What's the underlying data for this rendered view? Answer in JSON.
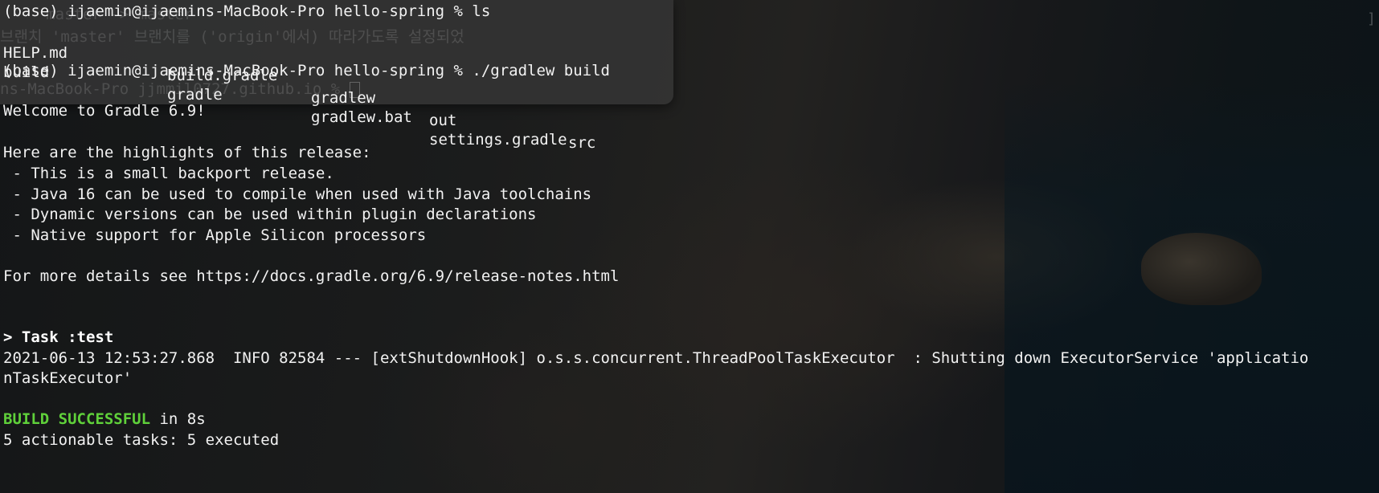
{
  "previous_window_ghost": {
    "line1": "     master -> master",
    "line2": "브랜치 'master' 브랜치를 ('origin'에서) 따라가도록 설정되었",
    "line3": "ns-MacBook-Pro jjmmil0727.github.io % "
  },
  "terminal": {
    "prompt_ls": "(base) ijaemin@ijaemins-MacBook-Pro hello-spring % ls",
    "ls_rows": [
      [
        "HELP.md",
        "build.gradle",
        "gradlew",
        "out",
        "src"
      ],
      [
        "build",
        "gradle",
        "gradlew.bat",
        "settings.gradle",
        ""
      ]
    ],
    "prompt_build": "(base) ijaemin@ijaemins-MacBook-Pro hello-spring % ./gradlew build",
    "welcome": "Welcome to Gradle 6.9!",
    "highlights_heading": "Here are the highlights of this release:",
    "highlights": [
      " - This is a small backport release.",
      " - Java 16 can be used to compile when used with Java toolchains",
      " - Dynamic versions can be used within plugin declarations",
      " - Native support for Apple Silicon processors"
    ],
    "details": "For more details see https://docs.gradle.org/6.9/release-notes.html",
    "task": "> Task :test",
    "log_line1": "2021-06-13 12:53:27.868  INFO 82584 --- [extShutdownHook] o.s.s.concurrent.ThreadPoolTaskExecutor  : Shutting down ExecutorService 'applicatio",
    "log_line2": "nTaskExecutor'",
    "build_status": "BUILD SUCCESSFUL",
    "build_time": " in 8s",
    "tasks_summary": "5 actionable tasks: 5 executed"
  },
  "colors": {
    "success": "#5fd03a",
    "text": "#f2f2f2"
  }
}
